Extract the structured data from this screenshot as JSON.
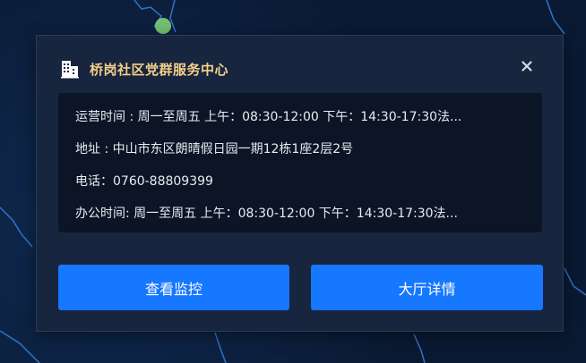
{
  "popup": {
    "title": "桥岗社区党群服务中心",
    "icon": "building-icon",
    "close_icon": "close-icon"
  },
  "info_rows": [
    {
      "text": "运营时间 : 周一至周五 上午：08:30-12:00 下午：14:30-17:30法..."
    },
    {
      "text": "地址 : 中山市东区朗晴假日园一期12栋1座2层2号"
    },
    {
      "text": "电话：0760-88809399"
    },
    {
      "text": "办公时间:  周一至周五 上午：08:30-12:00 下午：14:30-17:30法..."
    }
  ],
  "buttons": {
    "monitor_label": "查看监控",
    "hall_label": "大厅详情"
  },
  "colors": {
    "title": "#f3cf88",
    "primary_button": "#1677ff",
    "panel": "#18253f",
    "info_box": "#0b1525",
    "map_marker": "#7fd07a"
  }
}
